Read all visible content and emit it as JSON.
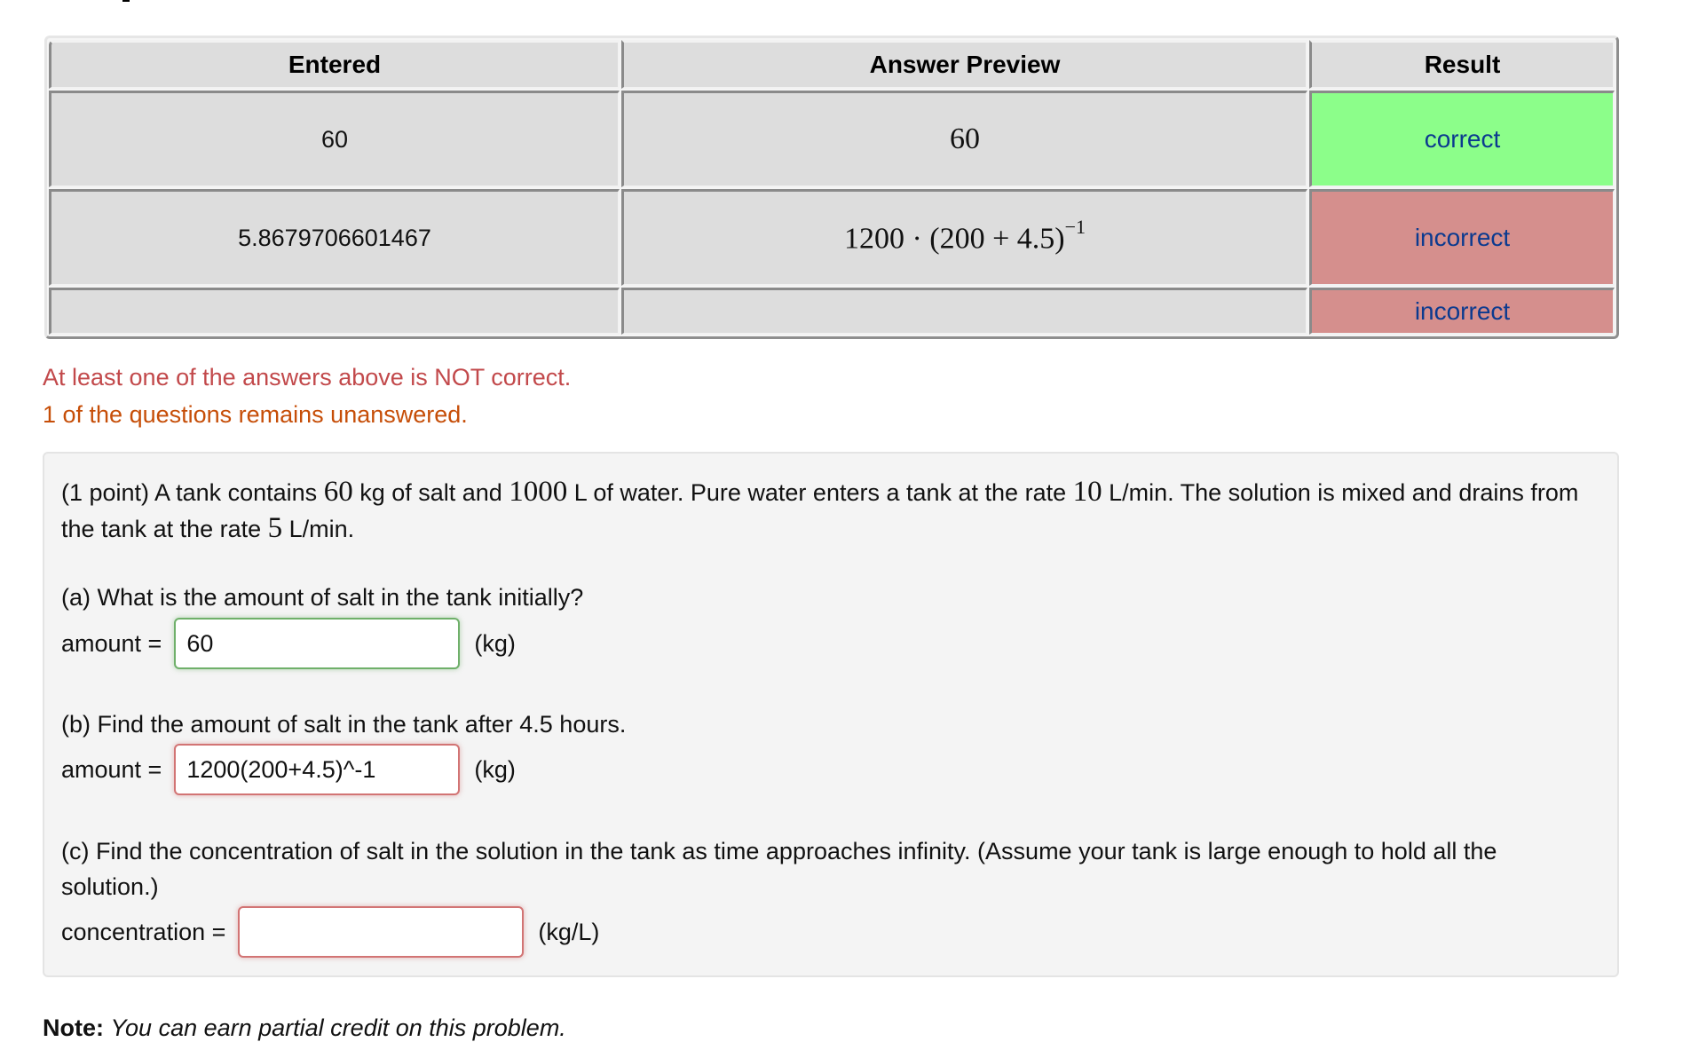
{
  "results_table": {
    "headers": [
      "Entered",
      "Answer Preview",
      "Result"
    ],
    "rows": [
      {
        "entered": "60",
        "preview_html": "60",
        "result": "correct",
        "status": "correct"
      },
      {
        "entered": "5.8679706601467",
        "preview_html": "1200 · (200 + 4.5)<sup>−1</sup>",
        "result": "incorrect",
        "status": "incorrect"
      },
      {
        "entered": "",
        "preview_html": "",
        "result": "incorrect",
        "status": "incorrect"
      }
    ]
  },
  "feedback": {
    "not_correct": "At least one of the answers above is NOT correct.",
    "unanswered": "1 of the questions remains unanswered."
  },
  "problem": {
    "intro_html": "(1 point) A tank contains <span class=\"math\">60</span> kg of salt and <span class=\"math\">1000</span> L of water. Pure water enters a tank at the rate <span class=\"math\">10</span> L/min. The solution is mixed and drains from the tank at the rate <span class=\"math\">5</span> L/min.",
    "parts": [
      {
        "question": "(a) What is the amount of salt in the tank initially?",
        "label": "amount =",
        "value": "60",
        "unit": "(kg)",
        "status": "correct"
      },
      {
        "question": "(b) Find the amount of salt in the tank after 4.5 hours.",
        "label": "amount =",
        "value": "1200(200+4.5)^-1",
        "unit": "(kg)",
        "status": "incorrect"
      },
      {
        "question": "(c) Find the concentration of salt in the solution in the tank as time approaches infinity. (Assume your tank is large enough to hold all the solution.)",
        "label": "concentration =",
        "value": "",
        "unit": "(kg/L)",
        "status": "incorrect"
      }
    ]
  },
  "note": {
    "label": "Note:",
    "text": "You can earn partial credit on this problem."
  },
  "colors": {
    "correct_bg": "#8cfe8a",
    "incorrect_bg": "#d58f8d",
    "result_text": "#0b3a8f",
    "feedback_wrong": "#c2494b",
    "feedback_unanswered": "#c64e08"
  }
}
